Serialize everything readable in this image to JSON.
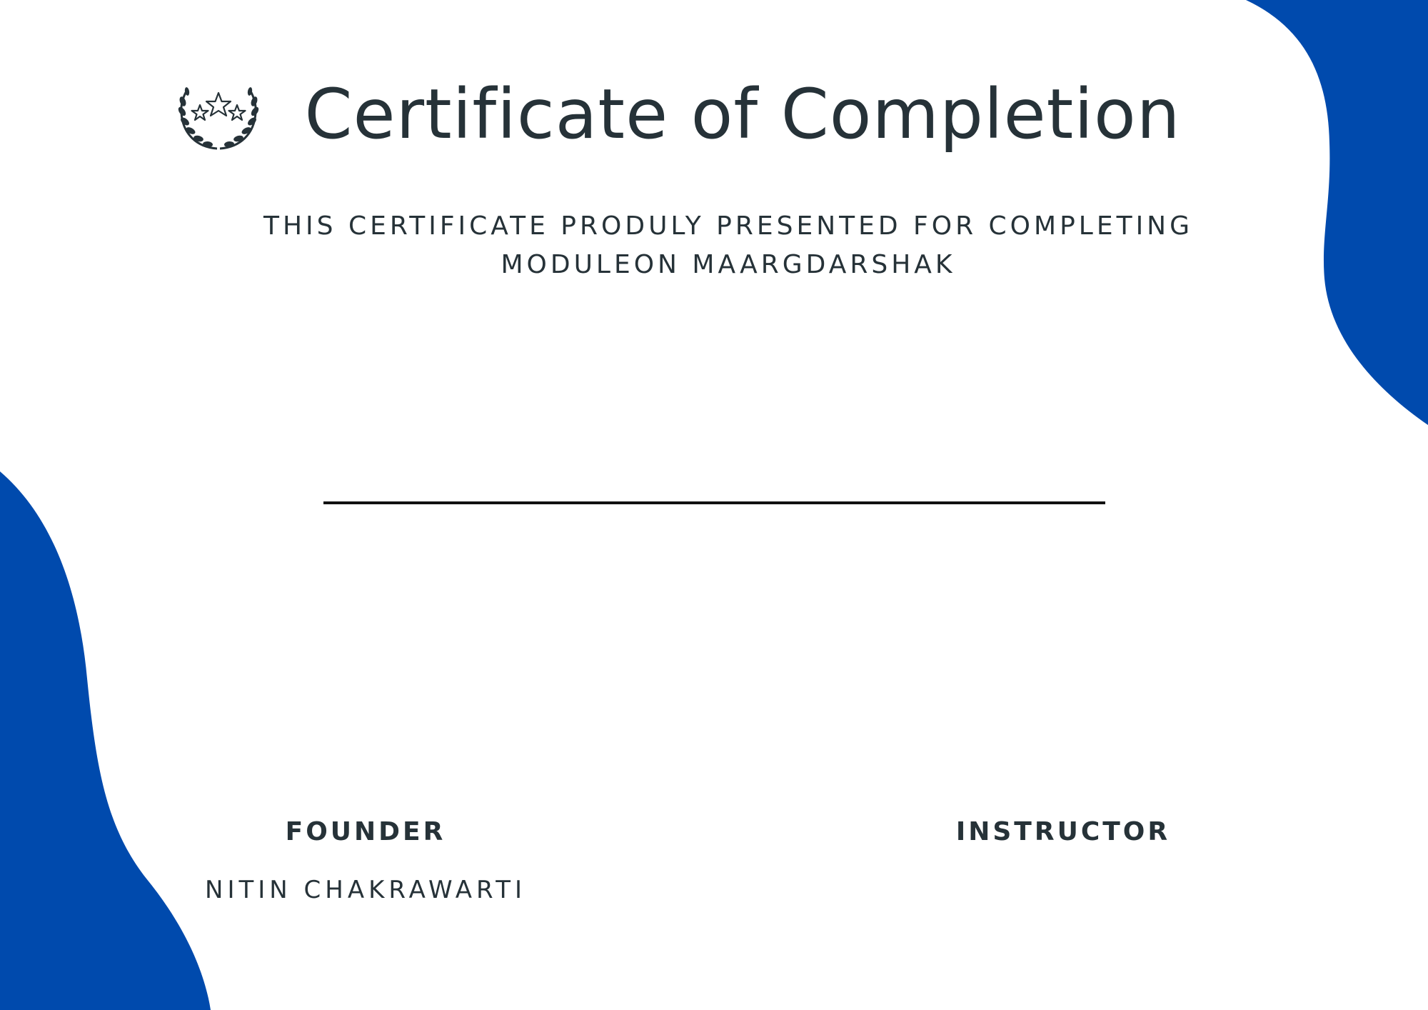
{
  "certificate": {
    "title": "Certificate of Completion",
    "subtitle": "THIS CERTIFICATE PRODULY PRESENTED FOR COMPLETING MODULEON MAARGDARSHAK",
    "signatures": {
      "founder_title": "FOUNDER",
      "founder_name": "NITIN CHAKRAWARTI",
      "instructor_title": "INSTRUCTOR"
    }
  },
  "colors": {
    "accent_blue": "#004AAD",
    "text_dark": "#263238",
    "background": "#FFFFFF"
  },
  "icons": {
    "emblem": "laurel-wreath-stars-icon"
  }
}
